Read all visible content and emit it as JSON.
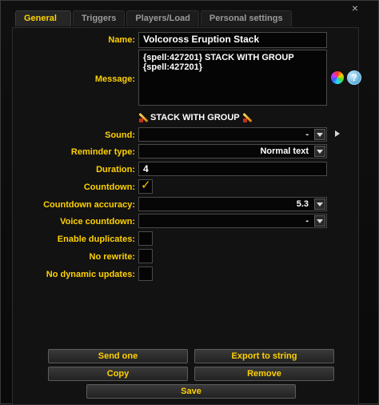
{
  "tabs": [
    "General",
    "Triggers",
    "Players/Load",
    "Personal settings"
  ],
  "close_glyph": "×",
  "fields": {
    "name_label": "Name:",
    "name_value": "Volcoross Eruption Stack",
    "message_label": "Message:",
    "message_line1": "{spell:427201} STACK WITH GROUP",
    "message_line2": "{spell:427201}",
    "preview_text": "STACK WITH GROUP",
    "sound_label": "Sound:",
    "sound_value": "-",
    "reminder_type_label": "Reminder type:",
    "reminder_type_value": "Normal text",
    "duration_label": "Duration:",
    "duration_value": "4",
    "countdown_label": "Countdown:",
    "countdown_checked": true,
    "countdown_accuracy_label": "Countdown accuracy:",
    "countdown_accuracy_value": "5.3",
    "voice_countdown_label": "Voice countdown:",
    "voice_countdown_value": "-",
    "enable_duplicates_label": "Enable duplicates:",
    "no_rewrite_label": "No rewrite:",
    "no_dynamic_updates_label": "No dynamic updates:"
  },
  "icons": {
    "color_wheel": "color-wheel-icon",
    "help": "help-icon",
    "help_glyph": "?",
    "checkmark_glyph": "✓",
    "preview_icon": "sword-spell-icon"
  },
  "buttons": {
    "send_one": "Send one",
    "export": "Export to string",
    "copy": "Copy",
    "remove": "Remove",
    "save": "Save"
  },
  "colors": {
    "label_gold": "#ffd100",
    "background": "#121212"
  }
}
